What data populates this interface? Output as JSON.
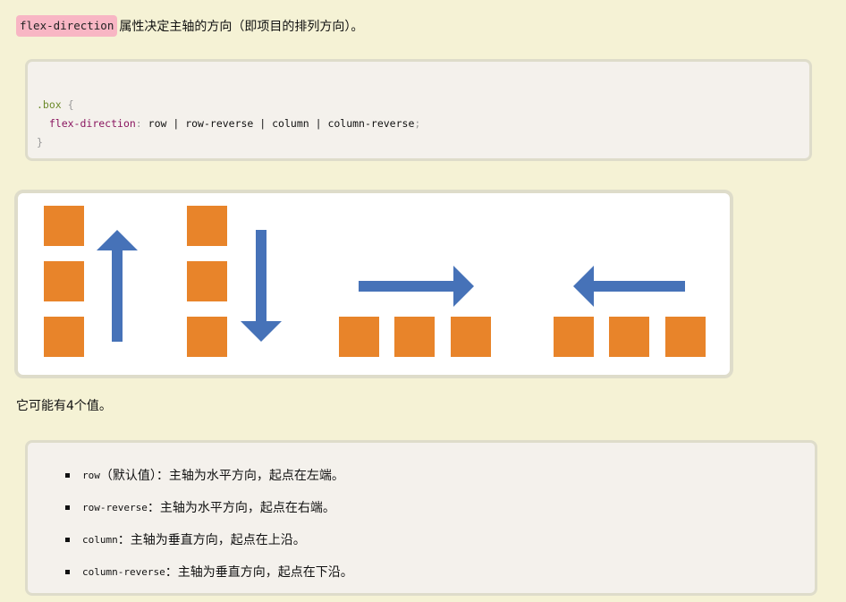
{
  "intro": {
    "code": "flex-direction",
    "text": "属性决定主轴的方向（即项目的排列方向）。"
  },
  "code_block": {
    "selector": ".box",
    "open_brace": " {",
    "property": "flex-direction",
    "colon": ":",
    "values": " row | row-reverse | column | column-reverse",
    "semicolon": ";",
    "close_brace": "}"
  },
  "figure": {
    "box_color": "#e8842a",
    "arrow_color": "#4672b8",
    "background": "#ffffff"
  },
  "values_text": "它可能有4个值。",
  "list": [
    {
      "code": "row",
      "text": "（默认值）：主轴为水平方向，起点在左端。"
    },
    {
      "code": "row-reverse",
      "text": "：主轴为水平方向，起点在右端。"
    },
    {
      "code": "column",
      "text": "：主轴为垂直方向，起点在上沿。"
    },
    {
      "code": "column-reverse",
      "text": "：主轴为垂直方向，起点在下沿。"
    }
  ]
}
